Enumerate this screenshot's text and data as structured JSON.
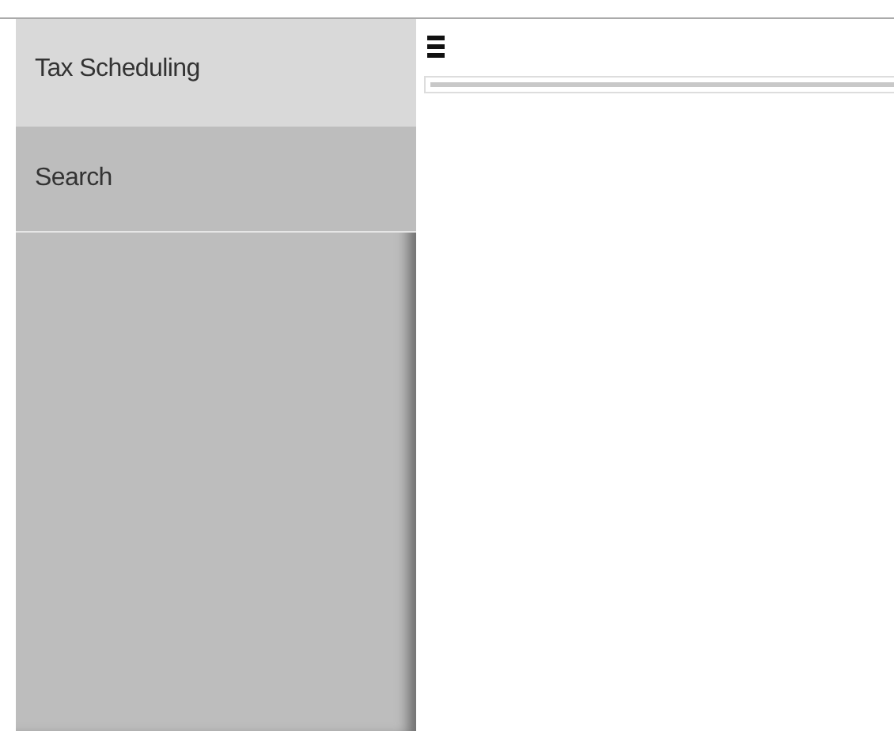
{
  "sidebar": {
    "items": [
      {
        "label": "Tax Scheduling",
        "selected": true
      },
      {
        "label": "Search",
        "selected": false
      }
    ]
  }
}
